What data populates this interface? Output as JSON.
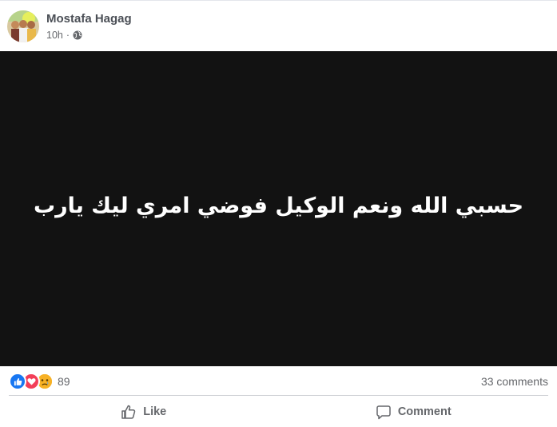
{
  "post": {
    "author": "Mostafa Hagag",
    "time": "10h",
    "separator": "·",
    "privacy_icon": "globe-icon",
    "media_text": "حسبي الله ونعم الوكيل فوضي امري ليك يارب",
    "media_background": "#121212"
  },
  "stats": {
    "reaction_icons": [
      "like-icon",
      "love-icon",
      "sad-icon"
    ],
    "reaction_count": "89",
    "comments": "33 comments"
  },
  "actions": {
    "like": "Like",
    "comment": "Comment"
  },
  "colors": {
    "like_blue": "#1877f2",
    "love_red": "#f33e58",
    "sad_yellow": "#f7b125",
    "secondary_text": "#65676b",
    "author_text": "#4b4f56"
  }
}
